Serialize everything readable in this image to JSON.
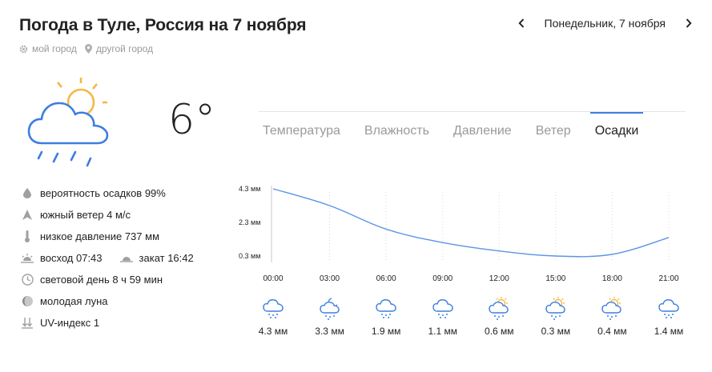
{
  "header": {
    "title": "Погода в Туле, Россия на 7 ноября",
    "my_city": "мой город",
    "other_city": "другой город",
    "date": "Понедельник, 7 ноября"
  },
  "current": {
    "temperature": "6°",
    "icon": "cloud-sun-rain-icon"
  },
  "details": {
    "precip": "вероятность осадков 99%",
    "wind": "южный ветер 4 м/с",
    "pressure": "низкое давление 737 мм",
    "sunrise": "восход 07:43",
    "sunset": "закат 16:42",
    "daylight": "световой день 8 ч 59 мин",
    "moon": "молодая луна",
    "uv": "UV-индекс 1"
  },
  "tabs": [
    {
      "label": "Температура"
    },
    {
      "label": "Влажность"
    },
    {
      "label": "Давление"
    },
    {
      "label": "Ветер"
    },
    {
      "label": "Осадки",
      "active": true
    }
  ],
  "colors": {
    "accent": "#3d7ee0",
    "line": "#5a95e6",
    "icon_gray": "#a0a0a0"
  },
  "chart_data": {
    "type": "line",
    "ylim": [
      0.3,
      4.3
    ],
    "y_ticks": [
      "4.3 мм",
      "2.3 мм",
      "0.3 мм"
    ],
    "x": [
      "00:00",
      "03:00",
      "06:00",
      "09:00",
      "12:00",
      "15:00",
      "18:00",
      "21:00"
    ],
    "series": [
      {
        "values": [
          4.3,
          3.3,
          1.9,
          1.1,
          0.6,
          0.3,
          0.4,
          1.4
        ]
      }
    ]
  },
  "hourly": [
    {
      "icon": "cloud-rain-icon",
      "value": "4.3 мм"
    },
    {
      "icon": "cloud-moon-rain-icon",
      "value": "3.3 мм"
    },
    {
      "icon": "cloud-rain-icon",
      "value": "1.9 мм"
    },
    {
      "icon": "cloud-rain-icon",
      "value": "1.1 мм"
    },
    {
      "icon": "cloud-sun-rain-icon",
      "value": "0.6 мм"
    },
    {
      "icon": "cloud-sun-rain-icon",
      "value": "0.3 мм"
    },
    {
      "icon": "cloud-sun-rain-icon",
      "value": "0.4 мм"
    },
    {
      "icon": "cloud-rain-icon",
      "value": "1.4 мм"
    }
  ]
}
